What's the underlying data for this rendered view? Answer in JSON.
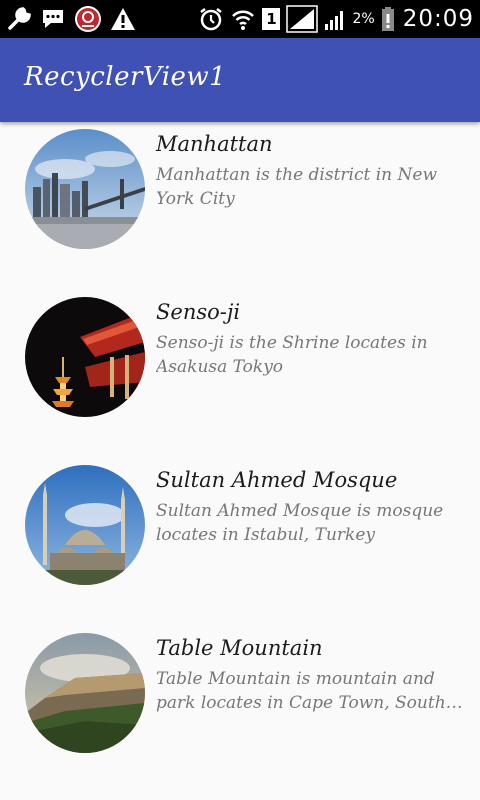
{
  "status_bar": {
    "icons_left": [
      "wrench-icon",
      "chat-icon",
      "alarm-badge-icon",
      "warning-icon"
    ],
    "sim_label": "1",
    "battery_percent": "2%",
    "time": "20:09"
  },
  "toolbar": {
    "title": "RecyclerView1",
    "color": "#3f51b5"
  },
  "list": {
    "items": [
      {
        "title": "Manhattan",
        "description": "Manhattan is the district in New York City",
        "image_icon": "city-skyline-image"
      },
      {
        "title": "Senso-ji",
        "description": "Senso-ji is the Shrine locates in Asakusa Tokyo",
        "image_icon": "pagoda-image"
      },
      {
        "title": "Sultan Ahmed Mosque",
        "description": "Sultan Ahmed Mosque is mosque locates in Istabul, Turkey",
        "image_icon": "mosque-image"
      },
      {
        "title": "Table Mountain",
        "description": "Table Mountain is mountain and park locates in Cape Town, South Africa",
        "image_icon": "mountain-image"
      }
    ]
  }
}
